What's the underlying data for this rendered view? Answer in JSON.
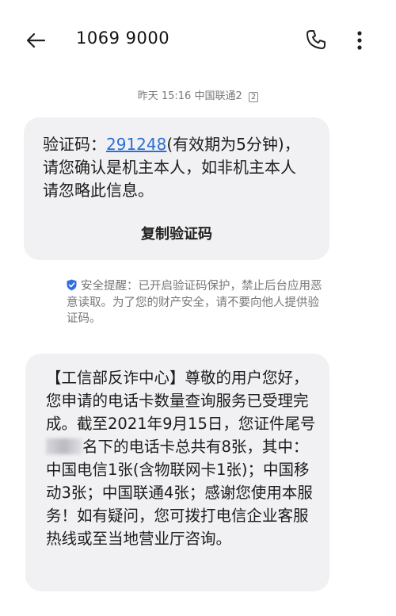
{
  "header": {
    "title": "1069 9000"
  },
  "meta": {
    "time": "昨天 15:16",
    "carrier": "中国联通2",
    "sim": "2"
  },
  "message1": {
    "prefix": "验证码：",
    "code": "291248",
    "rest": "(有效期为5分钟)，请您确认是机主本人，如非机主本人请忽略此信息。",
    "copy_label": "复制验证码"
  },
  "security_notice": "安全提醒：已开启验证码保护，禁止后台应用恶意读取。为了您的财产安全，请不要向他人提供验证码。",
  "message2": {
    "part1": "【工信部反诈中心】尊敬的用户您好，您申请的电话卡数量查询服务已受理完成。截至2021年9月15日，您证件尾号",
    "part2": "名下的电话卡总共有8张，其中：中国电信1张(含物联网卡1张)；中国移动3张；中国联通4张；感谢您使用本服务！如有疑问，您可拨打电信企业客服热线或至当地营业厅咨询。"
  },
  "colors": {
    "link": "#2b6fd6",
    "bubble": "#f1f1f3",
    "shield": "#2f6fe0"
  }
}
